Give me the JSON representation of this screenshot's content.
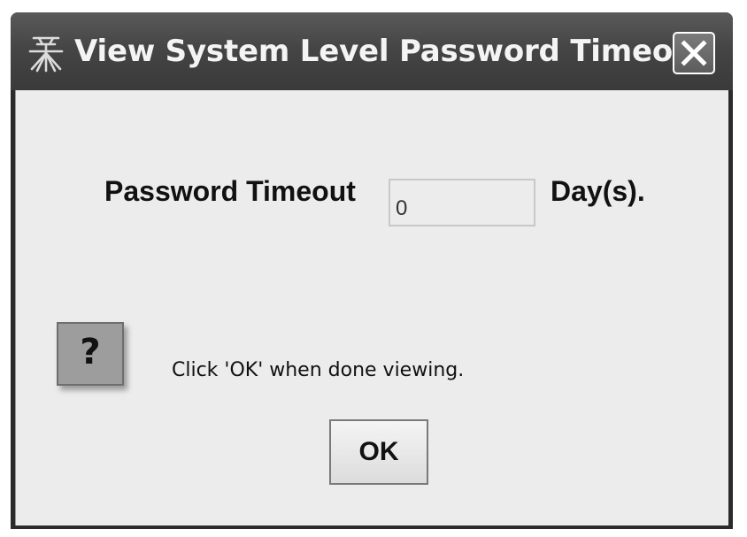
{
  "window": {
    "title": "View System Level Password Timeout",
    "close_icon": "close-icon",
    "app_icon": "java-logo-icon"
  },
  "form": {
    "label": "Password Timeout",
    "value": "0",
    "unit": "Day(s)."
  },
  "help": {
    "icon": "question-mark-icon",
    "glyph": "?",
    "message": "Click 'OK' when done viewing."
  },
  "actions": {
    "ok_label": "OK"
  }
}
